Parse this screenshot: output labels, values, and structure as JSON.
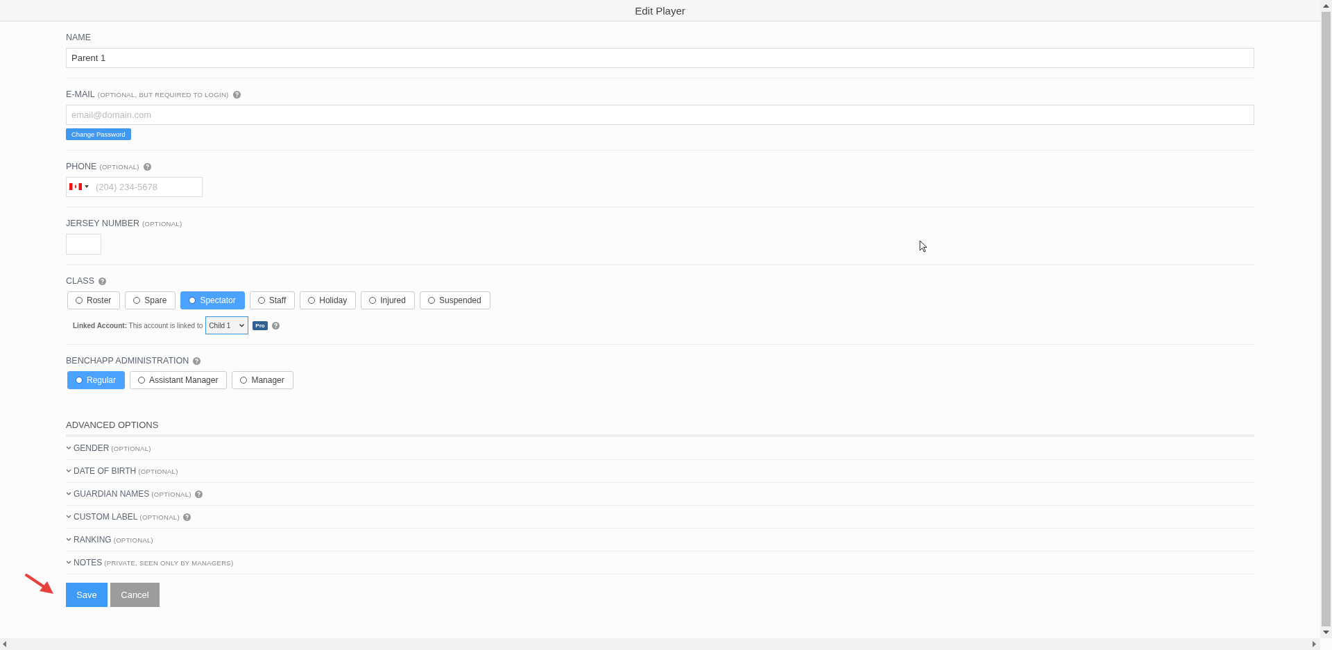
{
  "header": {
    "title": "Edit Player"
  },
  "name": {
    "label": "NAME",
    "value": "Parent 1"
  },
  "email": {
    "label": "E-MAIL",
    "note": "(OPTIONAL, BUT REQUIRED TO LOGIN)",
    "help": true,
    "placeholder": "email@domain.com",
    "button": "Change Password"
  },
  "phone": {
    "label": "PHONE",
    "note": "(OPTIONAL)",
    "help": true,
    "placeholder": "(204) 234-5678"
  },
  "jersey": {
    "label": "JERSEY NUMBER",
    "note": "(OPTIONAL)"
  },
  "class": {
    "label": "CLASS",
    "help": true,
    "options": [
      {
        "label": "Roster",
        "selected": false
      },
      {
        "label": "Spare",
        "selected": false
      },
      {
        "label": "Spectator",
        "selected": true
      },
      {
        "label": "Staff",
        "selected": false
      },
      {
        "label": "Holiday",
        "selected": false
      },
      {
        "label": "Injured",
        "selected": false
      },
      {
        "label": "Suspended",
        "selected": false
      }
    ],
    "linked": {
      "text": "**Linked Account:** This account is linked to",
      "value": "Child 1",
      "badge": "Pro",
      "help": true
    }
  },
  "admin": {
    "label": "BENCHAPP ADMINISTRATION",
    "help": true,
    "options": [
      {
        "label": "Regular",
        "selected": true
      },
      {
        "label": "Assistant Manager",
        "selected": false
      },
      {
        "label": "Manager",
        "selected": false
      }
    ]
  },
  "advanced": {
    "title": "ADVANCED OPTIONS",
    "items": [
      {
        "label": "GENDER",
        "note": "(OPTIONAL)",
        "help": false
      },
      {
        "label": "DATE OF BIRTH",
        "note": "(OPTIONAL)",
        "help": false
      },
      {
        "label": "GUARDIAN NAMES",
        "note": "(OPTIONAL)",
        "help": true
      },
      {
        "label": "CUSTOM LABEL",
        "note": "(OPTIONAL)",
        "help": true
      },
      {
        "label": "RANKING",
        "note": "(OPTIONAL)",
        "help": false
      },
      {
        "label": "NOTES",
        "note": "(PRIVATE, SEEN ONLY BY MANAGERS)",
        "help": false
      }
    ]
  },
  "actions": [
    {
      "label": "Save",
      "kind": "primary"
    },
    {
      "label": "Cancel",
      "kind": "secondary"
    }
  ]
}
